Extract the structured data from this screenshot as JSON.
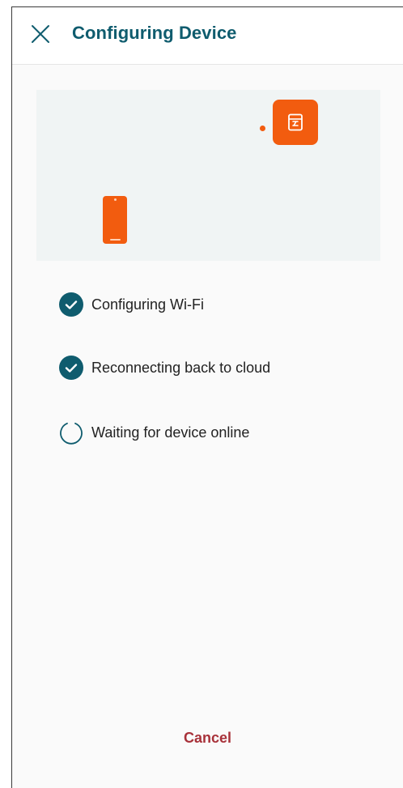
{
  "header": {
    "title": "Configuring Device",
    "close_icon": "close-icon"
  },
  "illustration": {
    "phone_icon": "smartphone-icon",
    "device_icon": "router-device-icon",
    "accent_color": "#f25c0f"
  },
  "steps": [
    {
      "label": "Configuring Wi-Fi",
      "status": "done",
      "icon": "check-circle-icon"
    },
    {
      "label": "Reconnecting back to cloud",
      "status": "done",
      "icon": "check-circle-icon"
    },
    {
      "label": "Waiting for device online",
      "status": "in-progress",
      "icon": "spinner-icon"
    }
  ],
  "footer": {
    "cancel_label": "Cancel"
  },
  "colors": {
    "title": "#0f5c6e",
    "check": "#0f5c6e",
    "cancel": "#a8323a"
  }
}
